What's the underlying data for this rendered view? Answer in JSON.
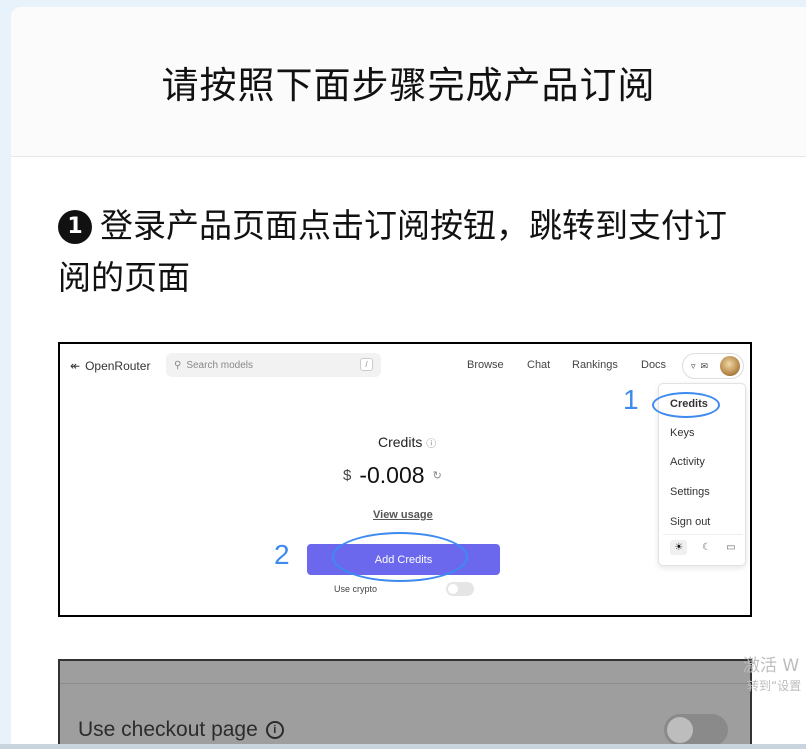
{
  "page": {
    "title": "请按照下面步骤完成产品订阅",
    "step1": {
      "number": "1",
      "text": "登录产品页面点击订阅按钮，跳转到支付订阅的页面"
    }
  },
  "screenshot1": {
    "logo_text": "OpenRouter",
    "logo_icon": "openrouter-logo-icon",
    "search_placeholder": "Search models",
    "search_shortcut": "/",
    "nav_links": [
      "Browse",
      "Chat",
      "Rankings",
      "Docs"
    ],
    "credits_title": "Credits",
    "currency": "$",
    "balance": "-0.008",
    "view_usage": "View usage",
    "add_credits": "Add Credits",
    "use_crypto": "Use crypto",
    "menu_items": [
      "Credits",
      "Keys",
      "Activity",
      "Settings",
      "Sign out"
    ],
    "theme_modes": [
      "light-mode-icon",
      "dark-mode-icon",
      "system-mode-icon"
    ],
    "annotation1": "1",
    "annotation2": "2",
    "accent_color": "#6b68ee",
    "annotation_color": "#3e8bf0"
  },
  "screenshot2": {
    "label": "Use checkout page",
    "info_icon": "info-icon"
  },
  "watermark": {
    "line1": "激活 W",
    "line2": "转到“设置"
  }
}
